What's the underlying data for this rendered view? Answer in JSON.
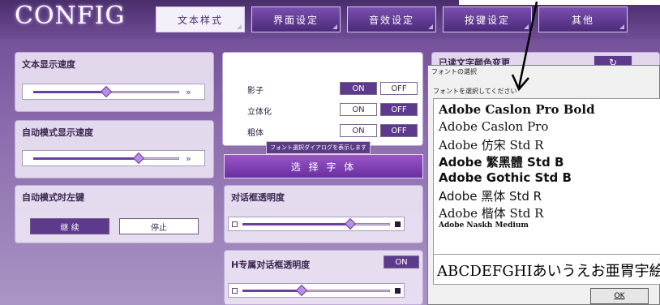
{
  "logo": "CONFIG",
  "tabs": [
    {
      "label": "文本样式",
      "active": true
    },
    {
      "label": "界面设定",
      "active": false
    },
    {
      "label": "音效设定",
      "active": false
    },
    {
      "label": "按键设定",
      "active": false
    },
    {
      "label": "其他",
      "active": false
    }
  ],
  "left": {
    "text_speed": {
      "title": "文本显示速度",
      "level": 0.5,
      "arrow": "»"
    },
    "auto_speed": {
      "title": "自动模式显示速度",
      "level": 0.72,
      "arrow": "»"
    },
    "auto_left_key": {
      "title": "自动模式时左键",
      "continue_label": "继 续",
      "stop_label": "停止"
    }
  },
  "middle": {
    "rows": [
      {
        "label": "影子",
        "on": "ON",
        "off": "OFF",
        "selected": "on"
      },
      {
        "label": "立体化",
        "on": "ON",
        "off": "OFF",
        "selected": "off"
      },
      {
        "label": "粗体",
        "on": "ON",
        "off": "OFF",
        "selected": "off"
      }
    ],
    "tooltip": "フォント選択ダイアログを表示します",
    "select_font_button": "选 择 字 体",
    "dialog_opacity": {
      "title": "对话框透明度",
      "level": 0.73
    },
    "h_dialog_opacity": {
      "title": "H专属对话框透明度",
      "toggle": "ON",
      "level": 0.4
    }
  },
  "right": {
    "text_color_title": "已读文字颜色变更",
    "refresh_icon": "refresh-icon"
  },
  "dialog": {
    "title": "フォントの選択",
    "subtitle": "フォントを選択してください",
    "fonts": [
      "Adobe Caslon Pro Bold",
      "Adobe Caslon Pro",
      "Adobe 仿宋 Std R",
      "Adobe 繁黑體 Std B",
      "Adobe Gothic Std B",
      "Adobe 黑体 Std R",
      "Adobe 楷体 Std R",
      "Adobe Naskh Medium"
    ],
    "preview": "ABCDEFGHIあいうえお亜胃宇絵御",
    "ok_label": "OK"
  },
  "colors": {
    "accent": "#5e3a8c",
    "panel": "#efe8f6"
  }
}
